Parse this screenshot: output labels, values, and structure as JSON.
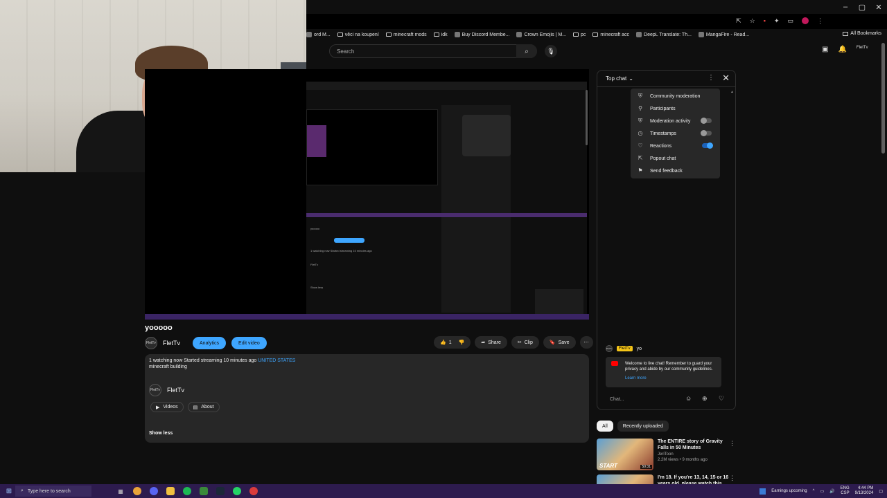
{
  "window": {
    "minimize": "–",
    "maximize": "▢",
    "close": "✕"
  },
  "bookmarks": [
    {
      "label": "ord M...",
      "icon": "favicon"
    },
    {
      "label": "věci na koupení",
      "icon": "folder"
    },
    {
      "label": "minecraft mods",
      "icon": "folder"
    },
    {
      "label": "idk",
      "icon": "folder"
    },
    {
      "label": "Buy Discord Membe...",
      "icon": "favicon"
    },
    {
      "label": "Crown Emojis | M...",
      "icon": "favicon"
    },
    {
      "label": "pc",
      "icon": "folder"
    },
    {
      "label": "minecraft acc",
      "icon": "folder"
    },
    {
      "label": "DeepL Translate: Th...",
      "icon": "favicon"
    },
    {
      "label": "MangaFire - Read...",
      "icon": "favicon"
    }
  ],
  "all_bookmarks": "All Bookmarks",
  "search": {
    "placeholder": "Search"
  },
  "video": {
    "title": "yooooo",
    "channel": "FletTv",
    "avatar_text": "FletTv",
    "analytics": "Analytics",
    "edit_video": "Edit video",
    "likes": "1",
    "share": "Share",
    "clip": "Clip",
    "save": "Save",
    "more": "⋯"
  },
  "description": {
    "watching": "1 watching now",
    "started": "Started streaming 10 minutes ago",
    "location": "UNITED STATES",
    "text": "minecraft building",
    "channel": "FletTv",
    "videos": "Videos",
    "about": "About",
    "show_less": "Show less"
  },
  "chat": {
    "mode": "Top chat",
    "menu": [
      {
        "label": "Community moderation",
        "icon": "shield-icon",
        "toggle": null
      },
      {
        "label": "Participants",
        "icon": "person-icon",
        "toggle": null
      },
      {
        "label": "Moderation activity",
        "icon": "shield-icon",
        "toggle": "off"
      },
      {
        "label": "Timestamps",
        "icon": "clock-icon",
        "toggle": "off"
      },
      {
        "label": "Reactions",
        "icon": "heart-icon",
        "toggle": "on"
      },
      {
        "label": "Popout chat",
        "icon": "popout-icon",
        "toggle": null
      },
      {
        "label": "Send feedback",
        "icon": "feedback-icon",
        "toggle": null
      }
    ],
    "message_author": "FletTv",
    "message_text": "yo",
    "welcome": "Welcome to live chat! Remember to guard your privacy and abide by our community guidelines.",
    "learn_more": "Learn more",
    "input_placeholder": "Chat..."
  },
  "recommendations": {
    "tabs": [
      "All",
      "Recently uploaded"
    ],
    "items": [
      {
        "title": "The ENTIRE story of Gravity Falls in 50 Minutes",
        "channel": "JeriToon",
        "meta": "2.2M views • 9 months ago",
        "duration": "50:31",
        "thumb_text": "START"
      },
      {
        "title": "I'm 18. If you're 13, 14, 15 or 16 years old, please watch this",
        "channel": "",
        "meta": "",
        "duration": "",
        "thumb_text": ""
      }
    ]
  },
  "taskbar": {
    "search_placeholder": "Type here to search",
    "earnings": "Earnings upcoming",
    "lang": "ENG",
    "region": "CSP",
    "time": "4:44 PM",
    "date": "9/13/2024"
  },
  "colors": {
    "accent": "#3ea6ff",
    "background": "#0f0f0f",
    "taskbar": "#2d1b4e",
    "youtube_red": "#ff0000"
  }
}
